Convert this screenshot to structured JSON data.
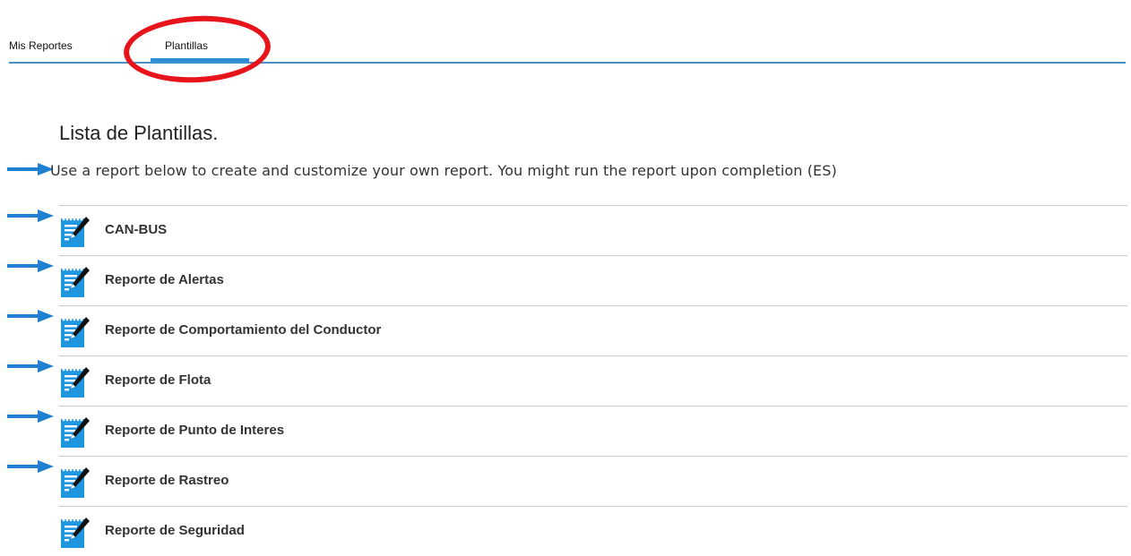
{
  "tabs": [
    {
      "label": "Mis Reportes",
      "active": false
    },
    {
      "label": "Plantillas",
      "active": true
    }
  ],
  "heading": "Lista de Plantillas.",
  "subtitle": "Use a report below to create and customize your own report. You might run the report upon completion (ES)",
  "templates": [
    {
      "label": "CAN-BUS",
      "icon": "edit-report-icon",
      "arrow": true
    },
    {
      "label": "Reporte de Alertas",
      "icon": "edit-report-icon",
      "arrow": true
    },
    {
      "label": "Reporte de Comportamiento del Conductor",
      "icon": "edit-report-icon",
      "arrow": true
    },
    {
      "label": "Reporte de Flota",
      "icon": "edit-report-icon",
      "arrow": true
    },
    {
      "label": "Reporte de Punto de Interes",
      "icon": "edit-report-icon",
      "arrow": true
    },
    {
      "label": "Reporte de Rastreo",
      "icon": "edit-report-icon",
      "arrow": true
    },
    {
      "label": "Reporte de Seguridad",
      "icon": "edit-report-icon",
      "arrow": false
    }
  ],
  "colors": {
    "accent": "#2c8fd6",
    "tab_border": "#4a90c8",
    "annotation": "#e8141c",
    "arrow": "#1f7fd0",
    "icon_blue": "#1e96e0"
  }
}
